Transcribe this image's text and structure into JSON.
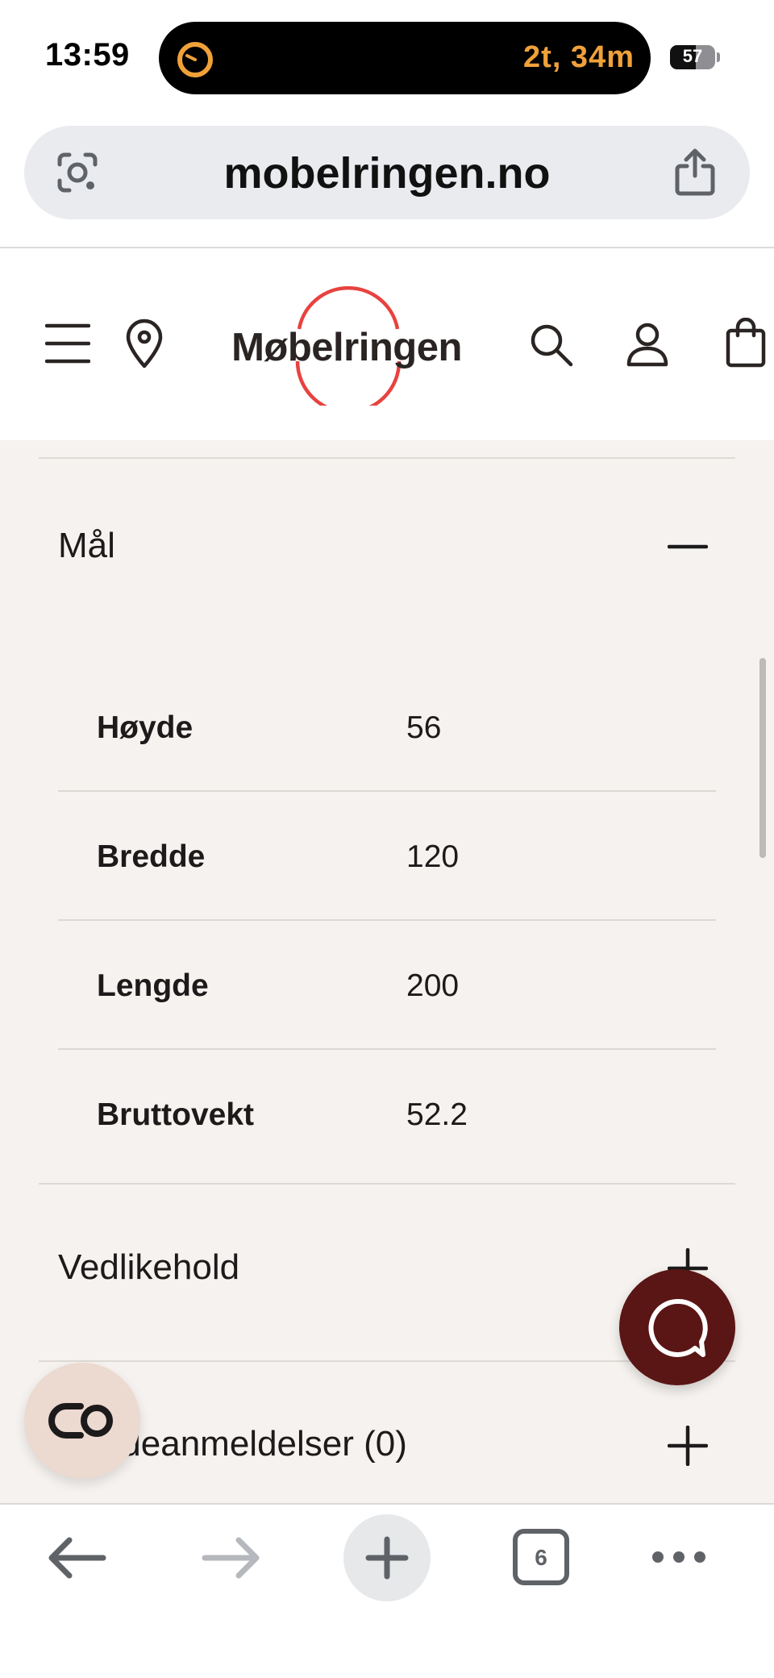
{
  "status_bar": {
    "time": "13:59",
    "live_activity": "2t, 34m",
    "battery": "57",
    "battery_level": 0.57
  },
  "browser": {
    "url": "mobelringen.no",
    "tab_count": "6"
  },
  "site": {
    "logo": "Møbelringen",
    "brand_color": "#e8423f"
  },
  "accordion": {
    "dimensions": {
      "title": "Mål",
      "expanded": true,
      "rows": [
        {
          "label": "Høyde",
          "value": "56"
        },
        {
          "label": "Bredde",
          "value": "120"
        },
        {
          "label": "Lengde",
          "value": "200"
        },
        {
          "label": "Bruttovekt",
          "value": "52.2"
        }
      ]
    },
    "maintenance": {
      "title": "Vedlikehold",
      "expanded": false
    },
    "reviews": {
      "title": "Kundeanmeldelser (0)",
      "expanded": false
    }
  },
  "colors": {
    "content_bg": "#f5f2ef",
    "chat_button": "#5a1515",
    "lens_button": "#ecd9d0",
    "live_activity_text": "#f0a13a"
  }
}
